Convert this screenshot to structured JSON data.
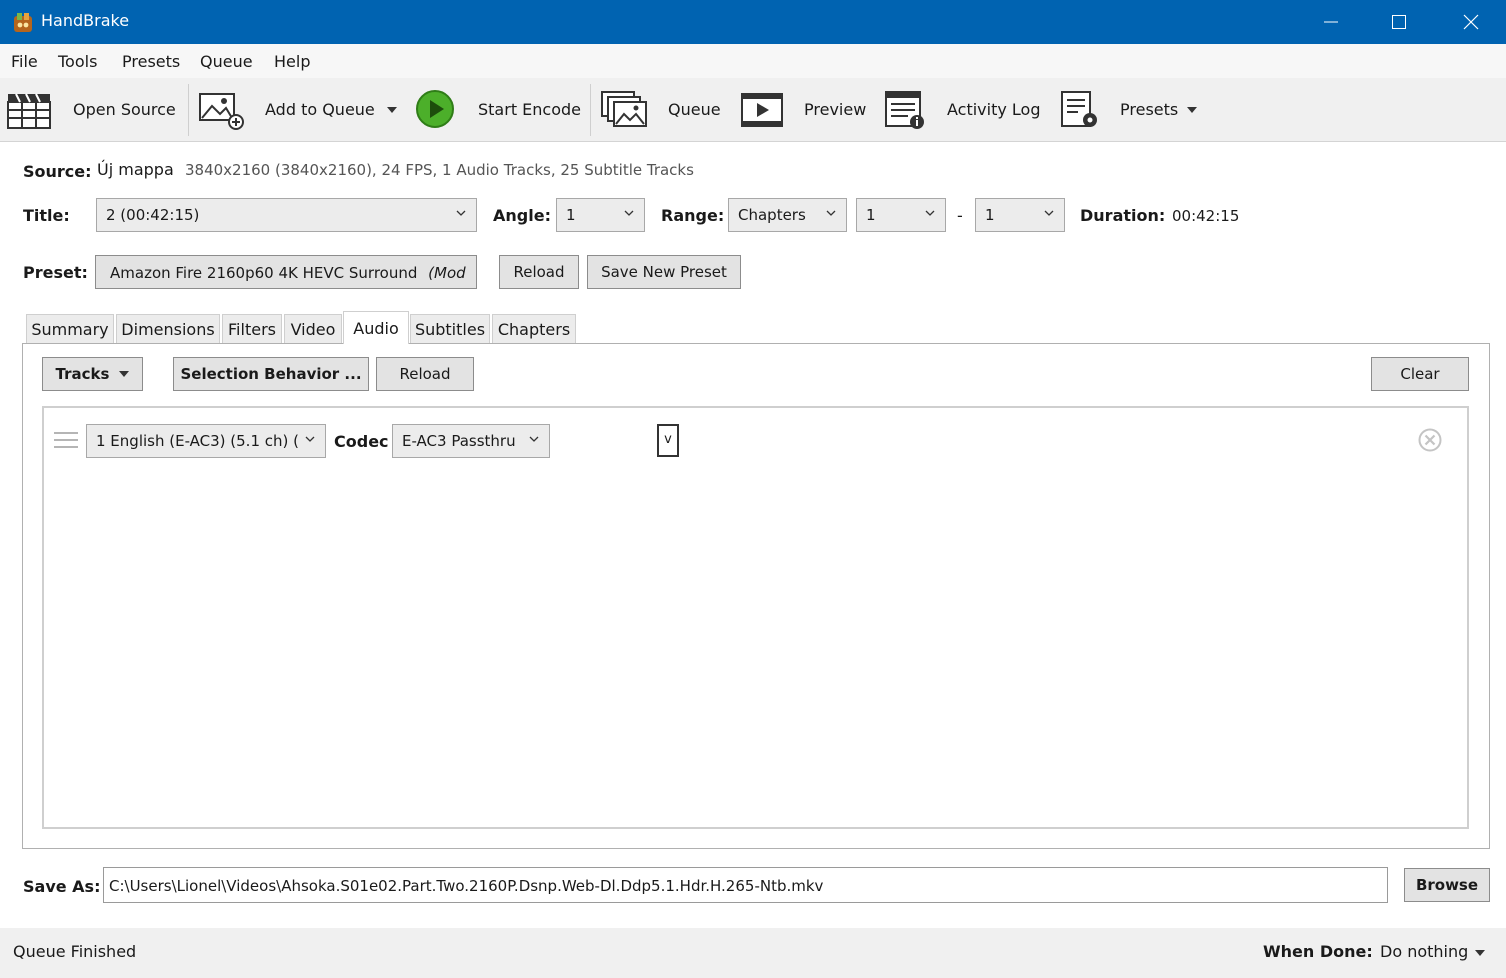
{
  "window": {
    "title": "HandBrake"
  },
  "menu": [
    "File",
    "Tools",
    "Presets",
    "Queue",
    "Help"
  ],
  "toolbar": {
    "open_source": "Open Source",
    "add_to_queue": "Add to Queue",
    "start_encode": "Start Encode",
    "queue": "Queue",
    "preview": "Preview",
    "activity_log": "Activity Log",
    "presets": "Presets"
  },
  "source": {
    "label": "Source:",
    "name": "Új mappa",
    "info": "3840x2160 (3840x2160), 24 FPS, 1 Audio Tracks, 25 Subtitle Tracks"
  },
  "title_row": {
    "title_label": "Title:",
    "title_value": "2  (00:42:15)",
    "angle_label": "Angle:",
    "angle_value": "1",
    "range_label": "Range:",
    "range_value": "Chapters",
    "range_start": "1",
    "range_dash": "-",
    "range_end": "1",
    "duration_label": "Duration:",
    "duration_value": "00:42:15"
  },
  "preset_row": {
    "label": "Preset:",
    "value": "Amazon Fire 2160p60 4K HEVC Surround",
    "value_suffix": "(Mod",
    "reload": "Reload",
    "save_new": "Save New Preset"
  },
  "tabs": [
    "Summary",
    "Dimensions",
    "Filters",
    "Video",
    "Audio",
    "Subtitles",
    "Chapters"
  ],
  "active_tab": "Audio",
  "audio": {
    "tracks_button": "Tracks",
    "selection_behavior": "Selection Behavior ...",
    "reload": "Reload",
    "clear": "Clear",
    "track": {
      "source": "1 English (E-AC3) (5.1 ch) (",
      "codec_label": "Codec",
      "codec_value": "E-AC3 Passthru",
      "small_box": "v"
    }
  },
  "save_as": {
    "label": "Save As:",
    "path": "C:\\Users\\Lionel\\Videos\\Ahsoka.S01e02.Part.Two.2160P.Dsnp.Web-Dl.Ddp5.1.Hdr.H.265-Ntb.mkv",
    "browse": "Browse"
  },
  "status": {
    "text": "Queue Finished",
    "when_done_label": "When Done:",
    "when_done_value": "Do nothing"
  },
  "colors": {
    "titlebar": "#0063b1",
    "play_green": "#4caf2a"
  }
}
